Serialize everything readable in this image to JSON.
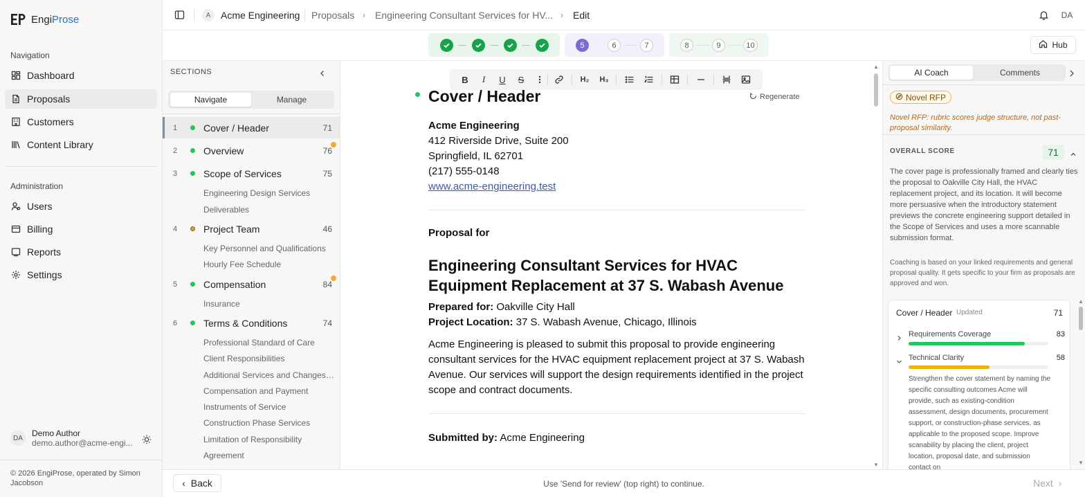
{
  "brand": {
    "name_a": "Engi",
    "name_b": "Prose"
  },
  "nav": {
    "group_label": "Navigation",
    "items": [
      {
        "label": "Dashboard",
        "icon": "dashboard-icon"
      },
      {
        "label": "Proposals",
        "icon": "proposals-icon"
      },
      {
        "label": "Customers",
        "icon": "customers-icon"
      },
      {
        "label": "Content Library",
        "icon": "library-icon"
      }
    ]
  },
  "admin": {
    "group_label": "Administration",
    "items": [
      {
        "label": "Users",
        "icon": "users-icon"
      },
      {
        "label": "Billing",
        "icon": "billing-icon"
      },
      {
        "label": "Reports",
        "icon": "reports-icon"
      },
      {
        "label": "Settings",
        "icon": "gear-icon"
      }
    ]
  },
  "user": {
    "initials": "DA",
    "name": "Demo Author",
    "email": "demo.author@acme-engi..."
  },
  "footer": {
    "copyright": "© 2026 EngiProse, operated by Simon Jacobson"
  },
  "topbar": {
    "org_initial": "A",
    "org_name": "Acme Engineering",
    "crumb_proposals": "Proposals",
    "crumb_proposal": "Engineering Consultant Services for HV...",
    "crumb_page": "Edit",
    "avatar": "DA"
  },
  "stepper": {
    "completed": [
      "1",
      "2",
      "3",
      "4"
    ],
    "current": "5",
    "group2_pending": [
      "6",
      "7"
    ],
    "group3_pending": [
      "8",
      "9",
      "10"
    ],
    "hub_label": "Hub"
  },
  "sections": {
    "title": "SECTIONS",
    "tab_navigate": "Navigate",
    "tab_manage": "Manage",
    "items": [
      {
        "num": "1",
        "label": "Cover / Header",
        "score": "71"
      },
      {
        "num": "2",
        "label": "Overview",
        "score": "76"
      },
      {
        "num": "3",
        "label": "Scope of Services",
        "score": "75"
      },
      {
        "num": "4",
        "label": "Project Team",
        "score": "46"
      },
      {
        "num": "5",
        "label": "Compensation",
        "score": "84"
      },
      {
        "num": "6",
        "label": "Terms & Conditions",
        "score": "74"
      }
    ],
    "sub_scope": [
      "Engineering Design Services",
      "Deliverables"
    ],
    "sub_team": [
      "Key Personnel and Qualifications",
      "Hourly Fee Schedule"
    ],
    "sub_comp": [
      "Insurance"
    ],
    "sub_terms": [
      "Professional Standard of Care",
      "Client Responsibilities",
      "Additional Services and Changes ...",
      "Compensation and Payment",
      "Instruments of Service",
      "Construction Phase Services",
      "Limitation of Responsibility",
      "Agreement"
    ]
  },
  "editor": {
    "regenerate": "Regenerate",
    "heading": "Cover / Header",
    "company": "Acme Engineering",
    "address1": "412 Riverside Drive, Suite 200",
    "address2": "Springfield, IL 62701",
    "phone": "(217) 555-0148",
    "website": "www.acme-engineering.test",
    "proposal_for": "Proposal for",
    "project_title": "Engineering Consultant Services for HVAC Equipment Replacement at 37 S. Wabash Avenue",
    "prepared_for_label": "Prepared for:",
    "prepared_for": "Oakville City Hall",
    "location_label": "Project Location:",
    "location": "37 S. Wabash Avenue, Chicago, Illinois",
    "intro": "Acme Engineering is pleased to submit this proposal to provide engineering consultant services for the HVAC equipment replacement project at 37 S. Wabash Avenue. Our services will support the design requirements identified in the project scope and contract documents.",
    "submitted_by_label": "Submitted by:",
    "submitted_by": "Acme Engineering"
  },
  "coach": {
    "tab_ai": "AI Coach",
    "tab_comments": "Comments",
    "badge": "Novel RFP",
    "novel_note": "Novel RFP: rubric scores judge structure, not past-proposal similarity.",
    "overall_label": "OVERALL SCORE",
    "overall_score": "71",
    "overall_text": "The cover page is professionally framed and clearly ties the proposal to Oakville City Hall, the HVAC replacement project, and its location. It will become more persuasive when the introductory statement previews the concrete engineering support detailed in the Scope of Services and uses a more scannable submission format.",
    "overall_note": "Coaching is based on your linked requirements and general proposal quality. It gets specific to your firm as proposals are approved and won.",
    "card_title": "Cover / Header",
    "card_updated": "Updated",
    "card_score": "71",
    "criteria": [
      {
        "name": "Requirements Coverage",
        "score": "83",
        "value": 0.83,
        "color": "#22c55e"
      },
      {
        "name": "Technical Clarity",
        "score": "58",
        "value": 0.58,
        "color": "#eab308"
      }
    ],
    "detail": "Strengthen the cover statement by naming the specific consulting outcomes Acme will provide, such as existing-condition assessment, design documents, procurement support, or construction-phase services, as applicable to the proposed scope. Improve scanability by placing the client, project location, proposal date, and submission contact on"
  },
  "bottombar": {
    "back": "Back",
    "hint": "Use 'Send for review' (top right) to continue.",
    "next": "Next"
  }
}
